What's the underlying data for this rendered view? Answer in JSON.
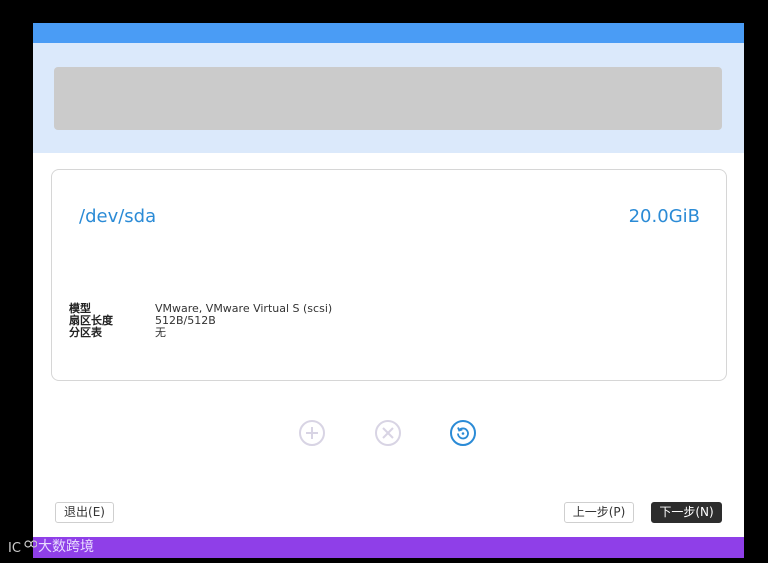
{
  "disk": {
    "path": "/dev/sda",
    "size": "20.0GiB",
    "info": [
      {
        "label": "模型",
        "value": "VMware, VMware Virtual S (scsi)"
      },
      {
        "label": "扇区长度",
        "value": "512B/512B"
      },
      {
        "label": "分区表",
        "value": "无"
      }
    ]
  },
  "actions": {
    "add_icon": "plus-circle-icon",
    "delete_icon": "x-circle-icon",
    "reset_icon": "refresh-circle-icon"
  },
  "footer": {
    "quit_label": "退出(E)",
    "prev_label": "上一步(P)",
    "next_label": "下一步(N)"
  },
  "watermark": {
    "text": "大数跨境"
  },
  "colors": {
    "accent": "#2b8bd6",
    "title_bar": "#4a9cf5",
    "header_band": "#dbe9fb",
    "bottom_bar": "#8f3fe8"
  }
}
